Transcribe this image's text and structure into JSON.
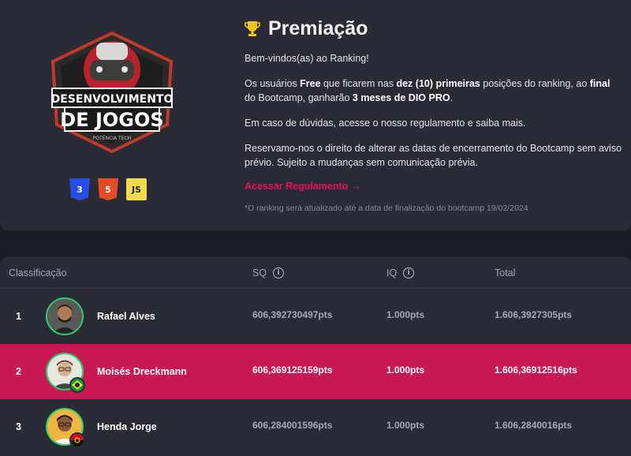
{
  "logo": {
    "line1": "DESENVOLVIMENTO",
    "line2": "DE JOGOS",
    "badge": "POTÊNCIA TECH"
  },
  "tech_icons": [
    "CSS3",
    "HTML5",
    "JS"
  ],
  "award": {
    "title": "Premiação",
    "welcome": "Bem-vindos(as) ao Ranking!",
    "para1_a": "Os usuários ",
    "para1_free": "Free",
    "para1_b": " que ficarem nas ",
    "para1_top": "dez (10) primeiras",
    "para1_c": " posições do ranking, ao ",
    "para1_final": "final",
    "para1_d": " do Bootcamp, ganharão ",
    "para1_prize": "3 meses de DIO PRO",
    "para1_e": ".",
    "para2": "Em caso de dúvidas, acesse o nosso regulamento e saiba mais.",
    "para3": "Reservamo-nos o direito de alterar as datas de encerramento do Bootcamp sem aviso prévio. Sujeito a mudanças sem comunicação prévia.",
    "link": "Acessar Regulamento",
    "link_arrow": "→",
    "note": "*O ranking será atualizado até a data de finalização do bootcamp 19/02/2024"
  },
  "table": {
    "headers": {
      "rank": "Classificação",
      "sq": "SQ",
      "iq": "IQ",
      "total": "Total"
    },
    "rows": [
      {
        "rank": "1",
        "name": "Rafael Alves",
        "sq": "606,392730497pts",
        "iq": "1.000pts",
        "total": "1.606,3927305pts"
      },
      {
        "rank": "2",
        "name": "Moisés Dreckmann",
        "sq": "606,369125159pts",
        "iq": "1.000pts",
        "total": "1.606,36912516pts"
      },
      {
        "rank": "3",
        "name": "Henda Jorge",
        "sq": "606,284001596pts",
        "iq": "1.000pts",
        "total": "1.606,2840016pts"
      }
    ]
  },
  "colors": {
    "accent": "#c71a55",
    "link": "#e4105d",
    "card": "#2b2b35",
    "bg": "#1d1d24"
  },
  "icons": [
    "trophy-icon",
    "info-icon",
    "arrow-right-icon",
    "brazil-flag-icon",
    "angola-flag-icon"
  ]
}
